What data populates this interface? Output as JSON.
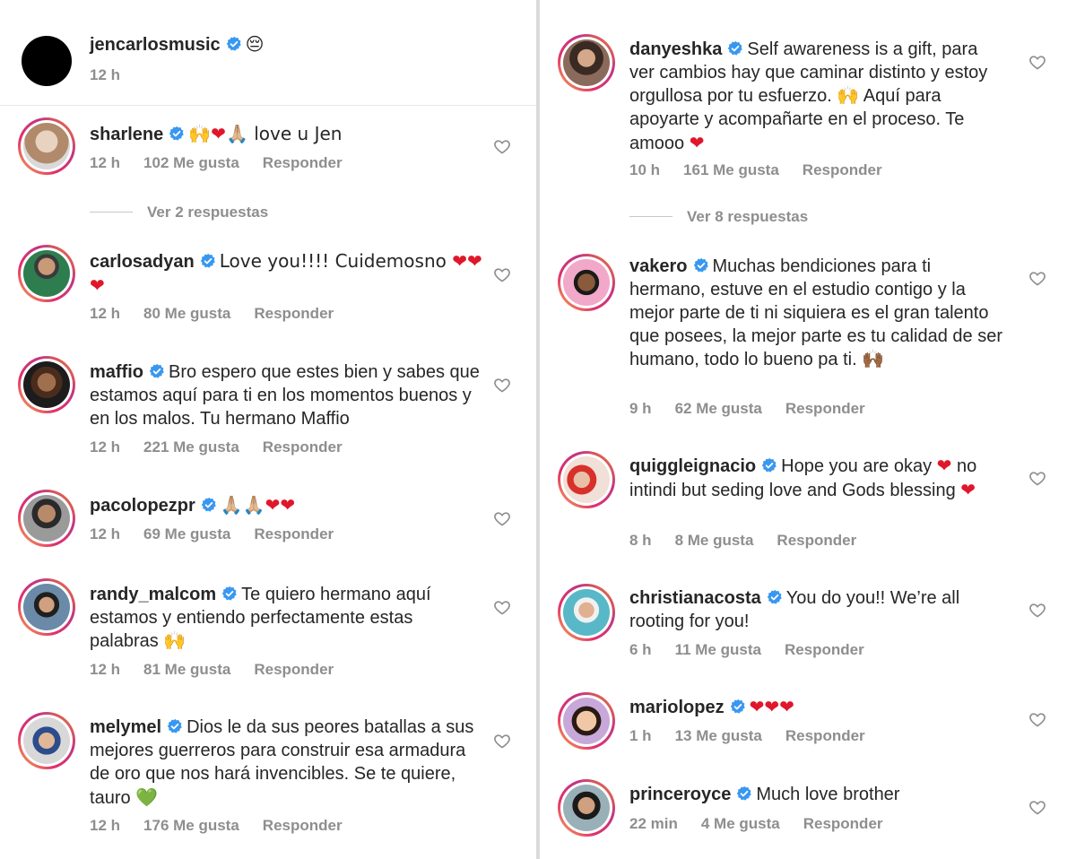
{
  "post": {
    "username": "jencarlosmusic",
    "caption_emoji": "😔",
    "time": "12 h"
  },
  "labels": {
    "reply": "Responder"
  },
  "left_comments": [
    {
      "username": "sharlene",
      "text": "🙌❤️🙏🏼 love u Jen",
      "time": "12 h",
      "likes": "102 Me gusta"
    },
    {
      "username": "carlosadyan",
      "text": "Love you!!!! Cuidemosno ❤️❤️❤️",
      "time": "12 h",
      "likes": "80 Me gusta"
    },
    {
      "username": "maffio",
      "text": "Bro espero que estes bien y sabes que estamos aquí para ti en los momentos buenos y en los malos. Tu hermano Maffio",
      "time": "12 h",
      "likes": "221 Me gusta"
    },
    {
      "username": "pacolopezpr",
      "text": "🙏🏼🙏🏼❤️❤️",
      "time": "12 h",
      "likes": "69 Me gusta"
    },
    {
      "username": "randy_malcom",
      "text": "Te quiero hermano aquí estamos y entiendo perfectamente estas palabras 🙌",
      "time": "12 h",
      "likes": "81 Me gusta"
    },
    {
      "username": "melymel",
      "text": "Dios le da sus peores batallas a sus mejores guerreros para construir esa armadura de oro que nos hará invencibles. Se te quiere, tauro 💚",
      "time": "12 h",
      "likes": "176 Me gusta"
    }
  ],
  "left_replies": "Ver 2 respuestas",
  "right_comments": [
    {
      "username": "danyeshka",
      "text": "Self awareness is a gift, para ver cambios hay que caminar distinto y estoy orgullosa por tu esfuerzo. 🙌 Aquí para apoyarte y acompañarte en el proceso. Te amooo ❤️",
      "time": "10 h",
      "likes": "161 Me gusta"
    },
    {
      "username": "vakero",
      "text": "Muchas bendiciones para ti hermano, estuve en el estudio contigo y la mejor parte de ti ni siquiera es el gran talento que posees, la mejor parte es tu calidad de ser humano, todo lo bueno pa ti. 🙌🏾",
      "time": "9 h",
      "likes": "62 Me gusta"
    },
    {
      "username": "quiggleignacio",
      "text": "Hope you are okay ❤️ no intindi but seding love and Gods blessing ❤️",
      "time": "8 h",
      "likes": "8 Me gusta"
    },
    {
      "username": "christianacosta",
      "text": "You do you!! We’re all rooting for you!",
      "time": "6 h",
      "likes": "11 Me gusta"
    },
    {
      "username": "mariolopez",
      "text": "❤️❤️❤️",
      "time": "1 h",
      "likes": "13 Me gusta"
    },
    {
      "username": "princeroyce",
      "text": "Much love brother",
      "time": "22 min",
      "likes": "4 Me gusta"
    }
  ],
  "right_replies": "Ver 8 respuestas",
  "colors": {
    "verified": "#3897f0",
    "meta_text": "#8e8e8e",
    "heart": "#e0162b"
  }
}
